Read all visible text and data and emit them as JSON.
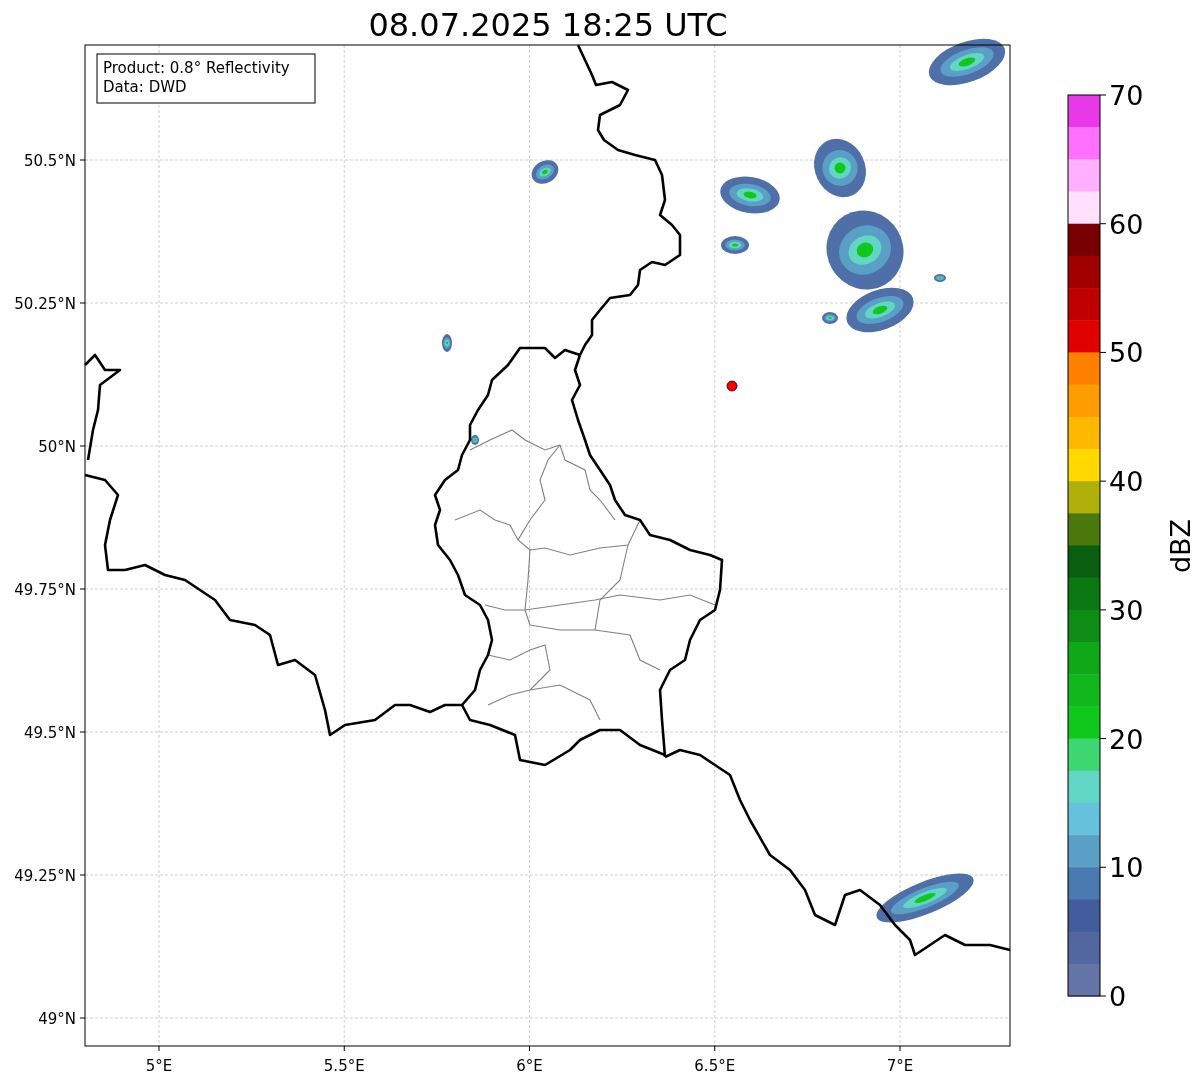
{
  "title": "08.07.2025 18:25 UTC",
  "legend": [
    "Product: 0.8° Reflectivity",
    "Data: DWD"
  ],
  "y_ticks": [
    "50.5°N",
    "50.25°N",
    "50°N",
    "49.75°N",
    "49.5°N",
    "49.25°N",
    "49°N"
  ],
  "x_ticks": [
    "5°E",
    "5.5°E",
    "6°E",
    "6.5°E",
    "7°E"
  ],
  "colorbar": {
    "label": "dBZ",
    "ticks": [
      "70",
      "60",
      "50",
      "40",
      "30",
      "20",
      "10",
      "0"
    ],
    "segments": [
      {
        "color": "#e838e8"
      },
      {
        "color": "#ff70ff"
      },
      {
        "color": "#ffb0ff"
      },
      {
        "color": "#ffe0ff"
      },
      {
        "color": "#780000"
      },
      {
        "color": "#a00000"
      },
      {
        "color": "#c00000"
      },
      {
        "color": "#e00000"
      },
      {
        "color": "#ff8000"
      },
      {
        "color": "#ff9c00"
      },
      {
        "color": "#ffb800"
      },
      {
        "color": "#ffd800"
      },
      {
        "color": "#b0b00a"
      },
      {
        "color": "#4a780c"
      },
      {
        "color": "#0a5e10"
      },
      {
        "color": "#0c7814"
      },
      {
        "color": "#0e8c16"
      },
      {
        "color": "#10a818"
      },
      {
        "color": "#10b81c"
      },
      {
        "color": "#10c81c"
      },
      {
        "color": "#3ed670"
      },
      {
        "color": "#62d6c4"
      },
      {
        "color": "#66c2dc"
      },
      {
        "color": "#5a9fc6"
      },
      {
        "color": "#4a7bb0"
      },
      {
        "color": "#425c9e"
      },
      {
        "color": "#52669f"
      },
      {
        "color": "#6474a6"
      }
    ]
  }
}
